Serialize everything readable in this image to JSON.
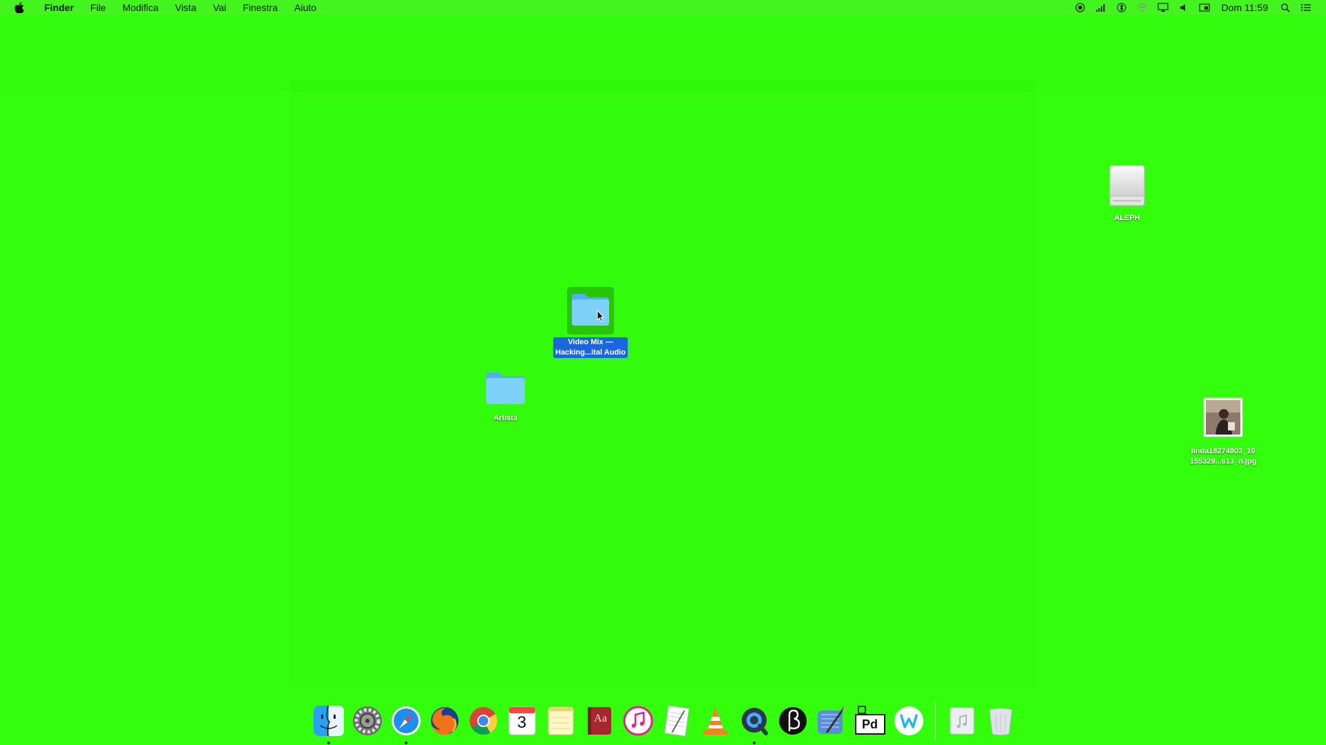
{
  "menubar": {
    "app_name": "Finder",
    "items": [
      "File",
      "Modifica",
      "Vista",
      "Vai",
      "Finestra",
      "Aiuto"
    ],
    "clock": "Dom 11:59",
    "status_icons": [
      "screen-record-icon",
      "signal-bars-icon",
      "bluetooth-icon",
      "wifi-icon",
      "airplay-icon",
      "volume-icon",
      "display-icon",
      "spotlight-icon",
      "notification-list-icon"
    ]
  },
  "desktop": {
    "background_color": "#33ff0c",
    "icons": {
      "drive": {
        "label": "ALEPH"
      },
      "video_folder": {
        "label_line1": "Video Mix —",
        "label_line2": "Hacking...ital Audio",
        "selected": true
      },
      "artists_folder": {
        "label": "Artists"
      },
      "image_file": {
        "label_line1": "linda18274803_10",
        "label_line2": "155329...613_n.jpg"
      }
    }
  },
  "dock": {
    "apps": [
      "finder",
      "system-preferences",
      "safari",
      "firefox",
      "chrome",
      "calendar",
      "notes",
      "dictionary",
      "itunes",
      "textedit",
      "vlc",
      "quicktime",
      "affinity",
      "xcode",
      "pure-data",
      "word-app"
    ],
    "calendar_day": "3",
    "dictionary_label": "Aa",
    "pd_label": "Pd",
    "trailing": [
      "music-folder",
      "trash"
    ]
  },
  "colors": {
    "selection_blue": "#1a66e0",
    "folder_blue": "#6ec8f5"
  }
}
